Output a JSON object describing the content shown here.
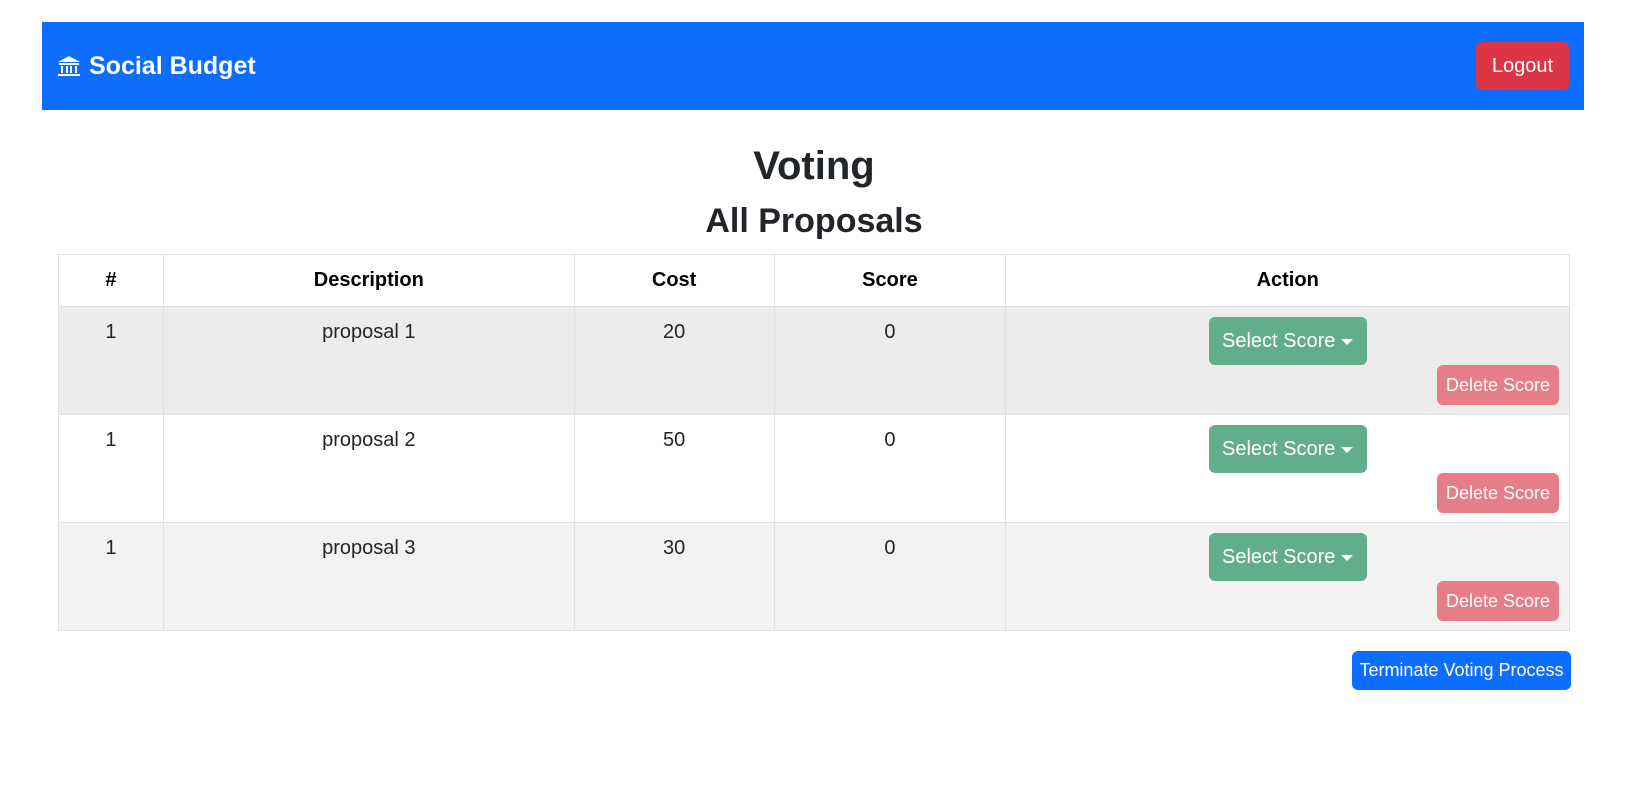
{
  "navbar": {
    "brand_icon": "bank-icon",
    "brand_label": "Social Budget",
    "logout_label": "Logout",
    "colors": {
      "primary": "#0d6efd",
      "danger": "#dc3545"
    }
  },
  "page": {
    "title": "Voting",
    "subtitle": "All Proposals"
  },
  "table": {
    "headers": [
      "#",
      "Description",
      "Cost",
      "Score",
      "Action"
    ],
    "rows": [
      {
        "num": "1",
        "description": "proposal 1",
        "cost": "20",
        "score": "0"
      },
      {
        "num": "1",
        "description": "proposal 2",
        "cost": "50",
        "score": "0"
      },
      {
        "num": "1",
        "description": "proposal 3",
        "cost": "30",
        "score": "0"
      }
    ],
    "select_label": "Select Score",
    "delete_label": "Delete Score",
    "colors": {
      "select": "#62ad8c",
      "delete": "#e57e88"
    }
  },
  "terminate_label": "Terminate Voting Process"
}
